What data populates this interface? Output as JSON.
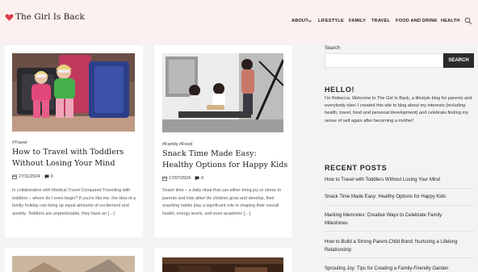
{
  "site": {
    "name": "The Girl Is Back"
  },
  "nav": {
    "items": [
      "ABOUT",
      "LIFESTYLE",
      "FAMILY",
      "TRAVEL",
      "FOOD AND DRINK",
      "HEALTH"
    ]
  },
  "posts": [
    {
      "category": "#Travel",
      "title": "How to Travel with Toddlers Without Losing Your Mind",
      "date": "27/11/2024",
      "comments": "0",
      "excerpt": "In collaboration with Medical Travel Compared Travelling with toddlers – where do I even begin? If you're like me, the idea of a family holiday can bring up equal amounts of excitement and anxiety. Toddlers are unpredictable, they have an […]"
    },
    {
      "category": "#Family #Food",
      "title": "Snack Time Made Easy: Healthy Options for Happy Kids",
      "date": "17/07/2024",
      "comments": "0",
      "excerpt": "Snack time – a daily ritual that can either bring joy or stress to parents and kids alike! As children grow and develop, their snacking habits play a significant role in shaping their overall health, energy levels, and even academic […]"
    }
  ],
  "sidebar": {
    "search_label": "Search",
    "search_button": "SEARCH",
    "hello_title": "HELLO!",
    "about_text": "I'm Rebecca. Welcome to The Girl Is Back, a lifestyle blog for parents and everybody else! I created this site to blog about my interests (including health, travel, food and personal development) and celebrate finding my sense of self again after becoming a mother!",
    "recent_title": "RECENT POSTS",
    "recent_posts": [
      "How to Travel with Toddlers Without Losing Your Mind",
      "Snack Time Made Easy: Healthy Options for Happy Kids",
      "Marking Memories: Creative Ways to Celebrate Family Milestones",
      "How to Build a Strong Parent-Child Bond: Nurturing a Lifelong Relationship",
      "Sprouting Joy: Tips for Creating a Family-Friendly Garden"
    ]
  },
  "colors": {
    "accent": "#e0394b",
    "header_bg": "#fdf1ef",
    "button_bg": "#2b2b2b"
  }
}
